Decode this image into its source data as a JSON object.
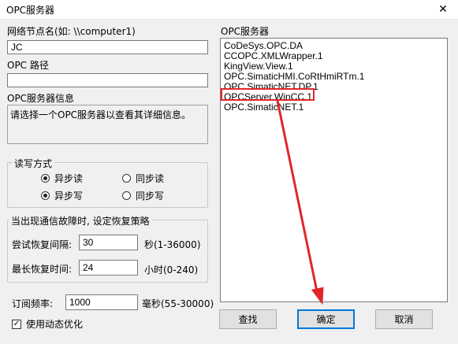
{
  "window": {
    "title": "OPC服务器",
    "close_glyph": "✕"
  },
  "node": {
    "label": "网络节点名(如: \\\\computer1)",
    "value": "JC"
  },
  "path": {
    "label": "OPC 路径",
    "value": ""
  },
  "info": {
    "label": "OPC服务器信息",
    "text": "请选择一个OPC服务器以查看其详细信息。"
  },
  "rw": {
    "legend": "读写方式",
    "async_read": "异步读",
    "sync_read": "同步读",
    "async_write": "异步写",
    "sync_write": "同步写"
  },
  "recovery": {
    "legend": "当出现通信故障时, 设定恢复策略",
    "interval_label": "尝试恢复间隔:",
    "interval_value": "30",
    "interval_unit": "秒(1-36000)",
    "max_label": "最长恢复时间:",
    "max_value": "24",
    "max_unit": "小时(0-240)"
  },
  "subscribe": {
    "label": "订阅频率:",
    "value": "1000",
    "unit": "毫秒(55-30000)"
  },
  "dynamic": {
    "label": "使用动态优化",
    "checked": true
  },
  "servers": {
    "label": "OPC服务器",
    "items": [
      "CoDeSys.OPC.DA",
      "CCOPC.XMLWrapper.1",
      "KingView.View.1",
      "OPC.SimaticHMI.CoRtHmiRTm.1",
      "OPC.SimaticNET.DP.1",
      "OPCServer.WinCC.1",
      "OPC.SimaticNET.1"
    ],
    "highlighted": "OPCServer.WinCC.1"
  },
  "buttons": {
    "find": "查找",
    "ok": "确定",
    "cancel": "取消"
  },
  "colors": {
    "annotation": "#e0262b",
    "background": "#f0f0f0"
  }
}
